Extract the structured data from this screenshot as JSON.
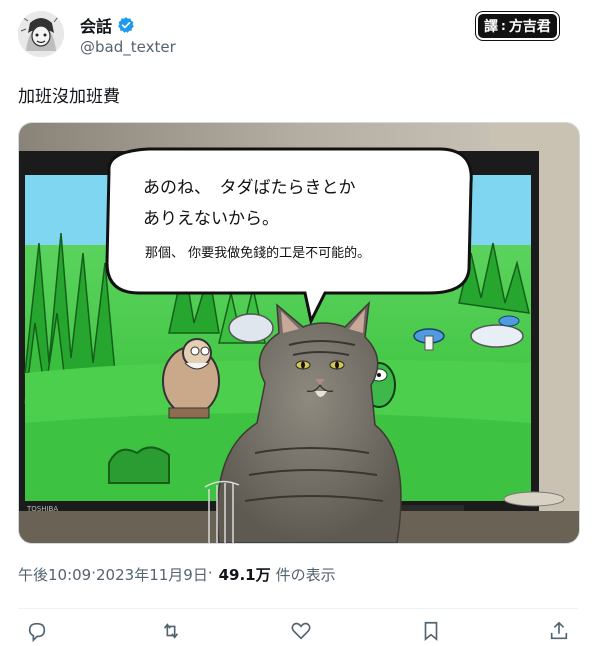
{
  "author": {
    "display_name": "会話",
    "handle": "@bad_texter",
    "verified": true,
    "avatar_icon": "manga-portrait-avatar"
  },
  "translator_tag": {
    "prefix": "譯",
    "colon": ":",
    "name": "方吉君"
  },
  "tweet": {
    "text": "加班沒加班費"
  },
  "media": {
    "speech_bubble": {
      "line1": "あのね、　タダばたらきとか",
      "line2": "ありえないから。",
      "translation": "那個、 你要我做免錢的工是不可能的。"
    },
    "tv_brand": "TOSHIBA"
  },
  "meta": {
    "time": "午後10:09",
    "separator1": " · ",
    "date": "2023年11月9日",
    "separator2": " · ",
    "views_count": "49.1万",
    "views_label": "件の表示"
  },
  "actions": {
    "reply_icon": "reply-icon",
    "retweet_icon": "retweet-icon",
    "like_icon": "like-icon",
    "bookmark_icon": "bookmark-icon",
    "share_icon": "share-icon"
  },
  "colors": {
    "verified_blue": "#1d9bf0",
    "secondary_text": "#536471",
    "primary_text": "#0f1419"
  }
}
